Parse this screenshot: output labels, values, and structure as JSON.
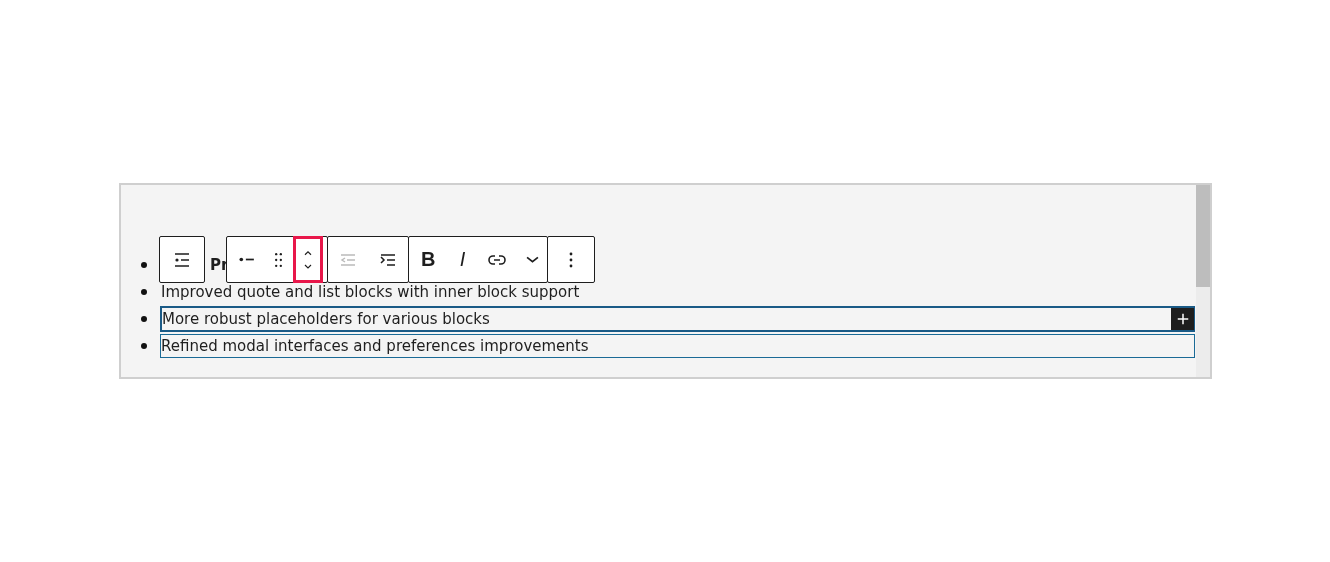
{
  "toolbar": {
    "groups": [
      {
        "buttons": [
          {
            "kind": "list-style",
            "disabled": false,
            "highlighted": false
          }
        ]
      },
      {
        "buttons": [
          {
            "kind": "list-item",
            "disabled": false,
            "highlighted": false
          },
          {
            "kind": "drag",
            "disabled": false,
            "highlighted": false
          },
          {
            "kind": "move",
            "disabled": false,
            "highlighted": true
          }
        ]
      },
      {
        "buttons": [
          {
            "kind": "outdent",
            "disabled": true,
            "highlighted": false
          },
          {
            "kind": "indent",
            "disabled": false,
            "highlighted": false
          }
        ]
      },
      {
        "buttons": [
          {
            "kind": "bold",
            "label": "B",
            "disabled": false,
            "highlighted": false
          },
          {
            "kind": "italic",
            "label": "I",
            "disabled": false,
            "highlighted": false
          },
          {
            "kind": "link",
            "disabled": false,
            "highlighted": false
          },
          {
            "kind": "more-formats",
            "disabled": false,
            "highlighted": false
          }
        ]
      },
      {
        "buttons": [
          {
            "kind": "options",
            "disabled": false,
            "highlighted": false
          }
        ]
      }
    ]
  },
  "list": {
    "items": [
      {
        "text": "Pr",
        "selected": false,
        "hovered": false,
        "covered": true
      },
      {
        "text": "Improved quote and list blocks with inner block support",
        "selected": false,
        "hovered": false,
        "covered": false
      },
      {
        "text": "More robust placeholders for various blocks",
        "selected": true,
        "hovered": false,
        "covered": false
      },
      {
        "text": "Refined modal interfaces and preferences improvements",
        "selected": false,
        "hovered": true,
        "covered": false
      }
    ]
  }
}
